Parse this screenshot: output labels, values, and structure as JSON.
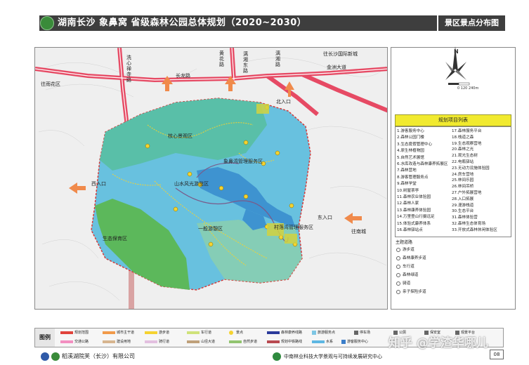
{
  "title": {
    "main": "湖南长沙 象鼻窝 省级森林公园总体规划（2020~2030）",
    "section": "景区景点分布图"
  },
  "map": {
    "areas": {
      "core": "核心景观区",
      "xiangbiwo": "象鼻湾管理服务区",
      "shanshui": "山水风光游览区",
      "yiban": "一般游憩区",
      "shengtai": "生态保育区",
      "cundong": "村落湾管理服务区"
    },
    "entrances": {
      "north": "北入口",
      "west": "西入口",
      "east": "东入口"
    },
    "roads": {
      "r1": "洗心禅寺路",
      "r2": "长龙路",
      "r3": "金洲大道",
      "r4": "黄花路",
      "r5": "漓湘东路",
      "r6": "漓湘路",
      "r7": "往雨花区",
      "r8": "往长沙国际新城",
      "r9": "往南城"
    },
    "points": [
      "1",
      "2",
      "3",
      "4",
      "5",
      "6",
      "7",
      "8",
      "9",
      "10",
      "11",
      "12",
      "13",
      "14",
      "15",
      "16",
      "17",
      "18",
      "19",
      "20",
      "21",
      "22",
      "23",
      "24",
      "25",
      "26",
      "27",
      "28",
      "29",
      "30",
      "31",
      "32",
      "33"
    ]
  },
  "compass": {
    "north": "N",
    "scale": "0   120   240m"
  },
  "project_list": {
    "title": "规划项目列表",
    "items": [
      "1.游客服务中心",
      "2.森林公园门楼",
      "3.生态度假管理中心",
      "4.原生林植物园",
      "5.自然艺术展馆",
      "6.水库改造与森林康养拓展区",
      "7.森林营地",
      "8.游客管理服务点",
      "9.森林学堂",
      "10.树屋茶亭",
      "11.森林农业体验园",
      "12.森林人家",
      "13.森林康养体验园",
      "14.万里登山行摄远足",
      "15.体验式康养体系",
      "16.森林驿站点",
      "17.森林服务平台",
      "18.栈道之森",
      "19.生态观察营地",
      "20.森林之光",
      "21.观光生态树",
      "22.电瓶驿站",
      "23.无动力设施体验园",
      "24.房车营地",
      "25.林间乐园",
      "26.林间吊桥",
      "27.户外拓展营地",
      "28.入口拓展",
      "29.漫游栈道",
      "30.生态平台",
      "31.森林体验营",
      "32.森林生态体育场",
      "33.开放式森林休闲体验区"
    ]
  },
  "themes": {
    "title": "主题道路",
    "items": [
      "游步道",
      "森林康养步道",
      "车行道",
      "森林绿道",
      "骑道",
      "亲子探险步道"
    ]
  },
  "legend": {
    "title": "图例",
    "items": [
      {
        "label": "规划范围",
        "color": "#e0433b"
      },
      {
        "label": "城市主干道",
        "color": "#f19a4a"
      },
      {
        "label": "游步道",
        "color": "#f5d230"
      },
      {
        "label": "车行道",
        "color": "#cfe27a"
      },
      {
        "label": "景点",
        "color": "#f5d230"
      },
      {
        "label": "森林康养线路",
        "color": "#2b3b9b"
      },
      {
        "label": "旅游服务点",
        "color": "#7ec6e4"
      },
      {
        "label": "停车场",
        "color": "#666666"
      },
      {
        "label": "公厕",
        "color": "#666666"
      },
      {
        "label": "保安室",
        "color": "#666666"
      },
      {
        "label": "观景平台",
        "color": "#666666"
      },
      {
        "label": "交通公路",
        "color": "#f38fc1"
      },
      {
        "label": "建设用地",
        "color": "#d7b58f"
      },
      {
        "label": "骑行道",
        "color": "#e3c0e0"
      },
      {
        "label": "山径大道",
        "color": "#bfa07a"
      },
      {
        "label": "自然步道",
        "color": "#92c470"
      },
      {
        "label": "规划中铁路线",
        "color": "#b84a50"
      },
      {
        "label": "水系",
        "color": "#5eb7e3"
      },
      {
        "label": "游客服务中心",
        "color": "#3b7ec9"
      }
    ]
  },
  "footer": {
    "left": "稻溪湖院芙（长沙）有限公司",
    "right": "中南林业科技大学景观与可持续发展研究中心",
    "page": "08"
  },
  "watermark": "知乎 @学渣华哪儿",
  "colors": {
    "title_bg": "#3e3e3e",
    "forest_blue": "#68c1df",
    "forest_green": "#5cb85b",
    "forest_teal": "#59bfa8",
    "water": "#3e93d0",
    "road": "#e64a64",
    "boundary": "#d53a3a",
    "arrow": "#f08a4b",
    "list_title_bg": "#f1ea2f"
  }
}
